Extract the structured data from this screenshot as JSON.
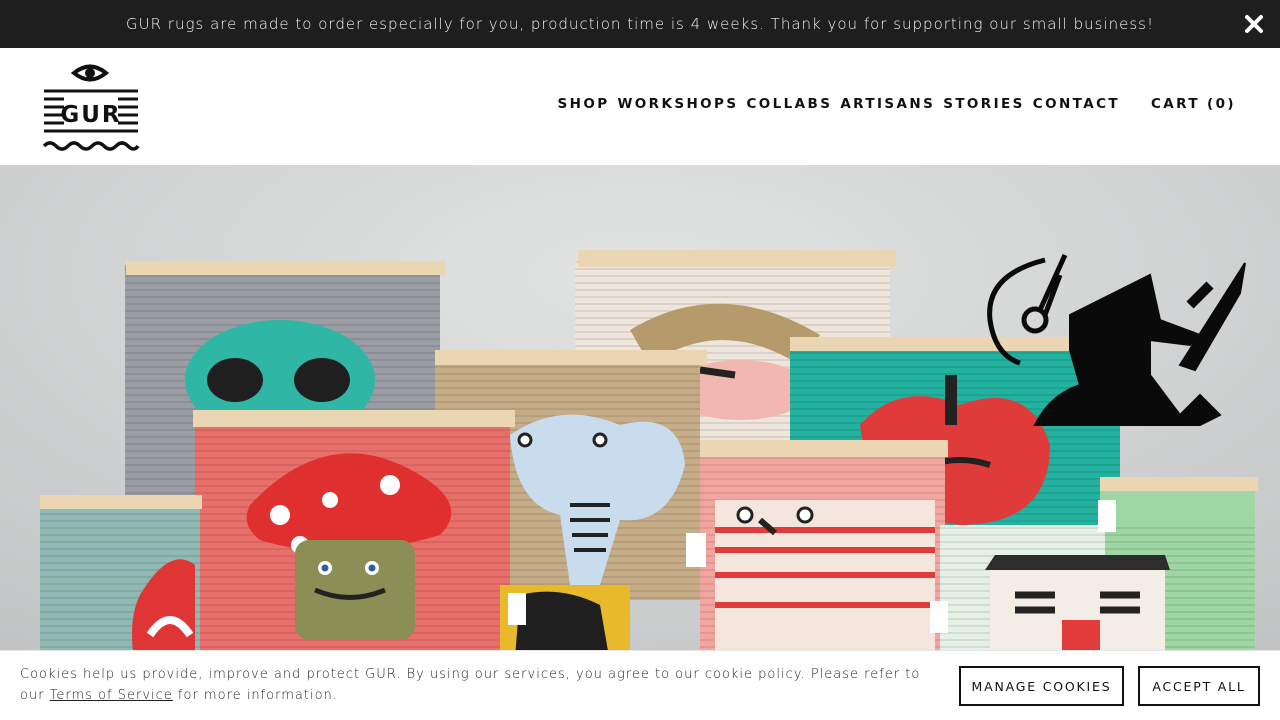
{
  "announcement": {
    "text": "GUR rugs are made to order especially for you, production time is 4 weeks. Thank you for supporting our small business!",
    "close_icon": "close-icon"
  },
  "header": {
    "logo_text": "GUR",
    "nav": [
      "SHOP",
      "WORKSHOPS",
      "COLLABS",
      "ARTISANS",
      "STORIES",
      "CONTACT"
    ],
    "cart_label": "CART (0)"
  },
  "cookie_banner": {
    "text_before": "Cookies help us provide, improve and protect GUR. By using our services, you agree to our cookie policy. Please refer to our ",
    "link_text": "Terms of Service",
    "text_after": " for more information.",
    "manage_label": "MANAGE COOKIES",
    "accept_label": "ACCEPT ALL"
  },
  "colors": {
    "announcement_bg": "#1e1e1e",
    "wall_bg": "#d2d3d3",
    "wood": "#ead6b3"
  }
}
